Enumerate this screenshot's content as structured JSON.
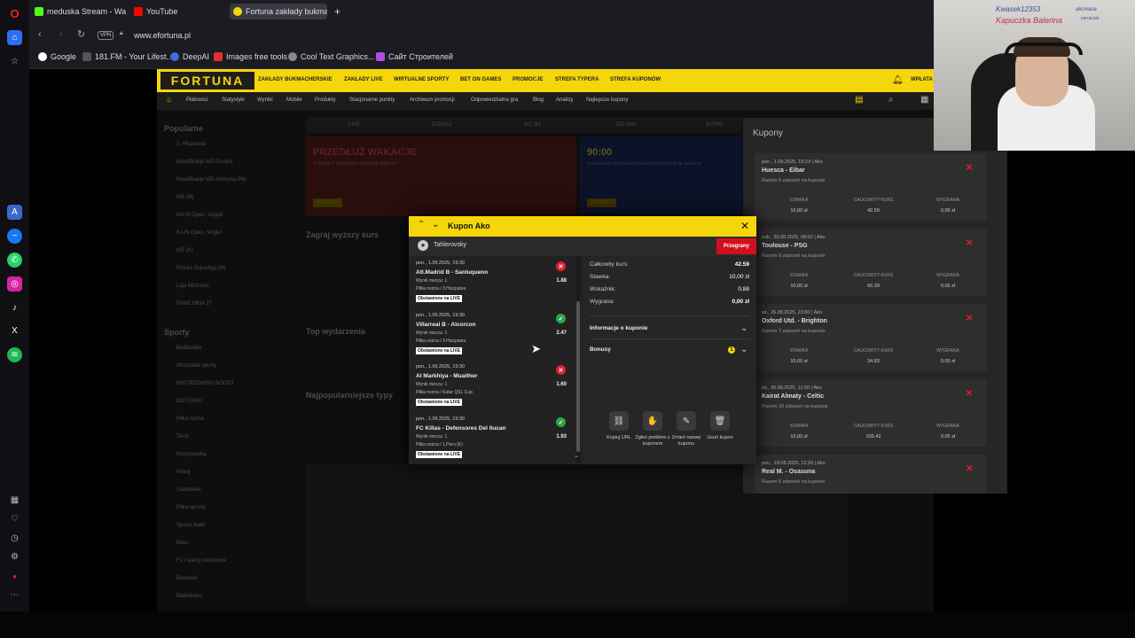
{
  "browser": {
    "tabs": [
      {
        "label": "meduska Stream - Wa",
        "color": "#53fc18"
      },
      {
        "label": "YouTube",
        "color": "#ff0000"
      },
      {
        "label": "Fortuna zakłady bukmach",
        "color": "#f5d60a"
      }
    ],
    "new_tab_label": "+",
    "vpn_label": "VPN",
    "url": "www.efortuna.pl",
    "bookmarks": [
      "Google",
      "181.FM - Your Lifest...",
      "DeepAI",
      "Images free tools",
      "Cool Text Graphics...",
      "Сайт Строителей"
    ]
  },
  "fortuna": {
    "logo": "FORTUNA",
    "main_nav": [
      "ZAKŁADY BUKMACHERSKIE",
      "ZAKŁADY LIVE",
      "WIRTUALNE SPORTY",
      "BET ON GAMES",
      "PROMOCJE",
      "STREFA TYPERA",
      "STREFA KUPONÓW"
    ],
    "wplata": "WPŁATA",
    "sub_nav": [
      "Płatności",
      "Statystyki",
      "Wyniki",
      "Mobile",
      "Produkty",
      "Stacjonarne punkty",
      "Archiwum promocji",
      "Odpowiedzialna gra",
      "Blog",
      "Analizy",
      "Najlepsze kupony"
    ],
    "sidebar_heading": "Popularne",
    "sidebar_items": [
      "2. Hiszpania",
      "Kwalifikacje MŚ-Europa",
      "Kwalifikacje MŚ-Ameryka Płd.",
      "MŚ (M)",
      "M-US Open, singiel",
      "K-US Open, singiel",
      "MŚ (K)",
      "Polska Superliga (M)",
      "Liga Mistrzów",
      "FAME MMA 27"
    ],
    "sports_heading": "Sporty",
    "sports_items": [
      "Bettbuilder",
      "Wszystkie sporty",
      "MISTRZOWSKI BOOST",
      "GOTÓWKI",
      "Piłka nożna",
      "Tenis",
      "Koszykówka",
      "Hokej",
      "Siatkówka",
      "Piłka ręczna",
      "Sporty walki",
      "Boks",
      "F1 i sporty motorowe",
      "Baseball",
      "Badminton"
    ],
    "time_tabs": [
      "LIVE",
      "DZISIAJ",
      "DO 3H",
      "DO 24H",
      "JUTRO"
    ],
    "banner1_title": "PRZEDŁUŻ WAKACJE",
    "banner1_sub": "SPRAWDŹ KONKURS NA FAME MMA 27!",
    "banner1_btn": "SPRAWDŹ",
    "banner2_title": "90:00",
    "banner2_sub": "ROZLICZAMY WYGRANĄ TWOJEJ DRUŻYNY W 90. MINUCIE",
    "banner2_btn": "SPRAWDŹ",
    "headings": [
      "Zagraj wyższy kurs",
      "Top wydarzenia",
      "Najpopularniejsze typy"
    ]
  },
  "kupony": {
    "title": "Kupony",
    "col_labels": [
      "STAWKA",
      "CAŁKOWITY KURS",
      "WYGRANA"
    ],
    "cards": [
      {
        "date": "pon., 1.09.2025, 19:23 | Ako",
        "teams": "Huesca - Eibar",
        "razem": "Razem 5 zdarzeń na kuponie",
        "stawka": "10,00 zł",
        "kurs": "42.59",
        "wygrana": "0,00 zł"
      },
      {
        "date": "sob., 30.08.2025, 08:02 | Ako",
        "teams": "Toulouse - PSG",
        "razem": "Razem 9 zdarzeń na kuponie",
        "stawka": "10,00 zł",
        "kurs": "66.39",
        "wygrana": "0,00 zł"
      },
      {
        "date": "wt., 26.08.2025, 23:00 | Ako",
        "teams": "Oxford Utd. - Brighton",
        "razem": "Razem 7 zdarzeń na kuponie",
        "stawka": "10,00 zł",
        "kurs": "34.83",
        "wygrana": "0,00 zł"
      },
      {
        "date": "wt., 26.08.2025, 11:00 | Ako",
        "teams": "Kairat Almaty - Celtic",
        "razem": "Razem 10 zdarzeń na kuponie",
        "stawka": "10,00 zł",
        "kurs": "205.42",
        "wygrana": "0,00 zł"
      },
      {
        "date": "pon., 18.08.2025, 12:20 | Ako",
        "teams": "Real M. - Osasuna",
        "razem": "Razem 5 zdarzeń na kuponie",
        "stawka": "",
        "kurs": "",
        "wygrana": ""
      }
    ]
  },
  "webcam": {
    "whiteboard_lines": [
      "Kwasek12353",
      "Kapuczka Balerina",
      "akcinace",
      "cerraccio"
    ]
  },
  "modal": {
    "title": "Kupon Ako",
    "username": "Tahlerovsky",
    "status": "Przegrany",
    "bets": [
      {
        "date": "pon., 1.09.2025, 19:30",
        "teams": "Atl.Madrid B - Sanluqueno",
        "market": "Wynik meczu: 1",
        "sport": "Piłka nożna / 3.Hiszpania",
        "live": "Obstawione na LIVE",
        "odds": "1.88",
        "result": "lost"
      },
      {
        "date": "pon., 1.09.2025, 19:30",
        "teams": "Villarreal B - Alcorcon",
        "market": "Wynik meczu: 1",
        "sport": "Piłka nożna / 3.Hiszpania",
        "live": "Obstawione na LIVE",
        "odds": "2.47",
        "result": "won"
      },
      {
        "date": "pon., 1.09.2025, 19:30",
        "teams": "Al Markhiya - Muaither",
        "market": "Wynik meczu: 1",
        "sport": "Piłka nożna / Katar QSL Cup",
        "live": "Obstawione na LIVE",
        "odds": "1.60",
        "result": "lost"
      },
      {
        "date": "pon., 1.09.2025, 19:30",
        "teams": "FC Killas - Defensores Del Ilucan",
        "market": "Wynik meczu: 1",
        "sport": "Piłka nożna / 1.Peru (K)",
        "live": "Obstawione na LIVE",
        "odds": "1.93",
        "result": "won"
      }
    ],
    "summary": [
      {
        "label": "Całkowity kurs:",
        "value": "42.59"
      },
      {
        "label": "Stawka:",
        "value": "10,00 zł"
      },
      {
        "label": "Wskaźnik:",
        "value": "0,88"
      },
      {
        "label": "Wygrana:",
        "value": "0,00 zł"
      }
    ],
    "info_label": "Informacje o kuponie",
    "bonus_label": "Bonusy",
    "bonus_count": "1",
    "actions": [
      {
        "label": "Kopiuj URL",
        "icon": "link-icon"
      },
      {
        "label": "Zgłoś problem z kuponem",
        "icon": "report-icon"
      },
      {
        "label": "Zmień nazwę kuponu",
        "icon": "pencil-icon"
      },
      {
        "label": "Usuń kupon",
        "icon": "trash-icon"
      }
    ]
  },
  "colors": {
    "accent": "#f5d60a",
    "lost": "#e02030",
    "won": "#2ca64a"
  }
}
